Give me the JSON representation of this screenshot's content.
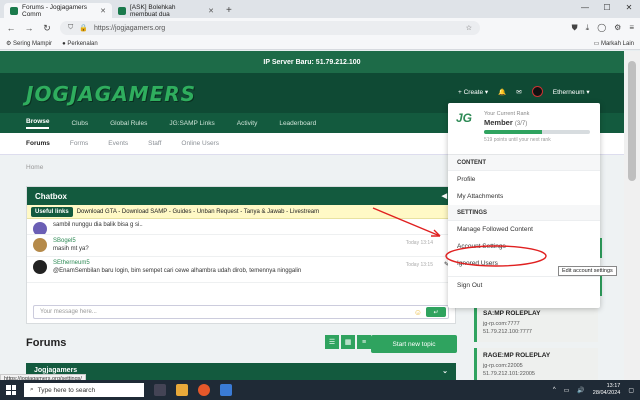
{
  "browser": {
    "tabs": [
      {
        "title": "Forums - Jogjagamers Comm",
        "active": true
      },
      {
        "title": "[ASK] Bolehkah membuat dua",
        "active": false
      }
    ],
    "url": "https://jogjagamers.org",
    "bookmarks": [
      "Sering Mampir",
      "Perkenalan"
    ],
    "other_bookmarks": "Markah Lain"
  },
  "site": {
    "server_banner": "IP Server Baru: 51.79.212.100",
    "logo_text": "JOGJAGAMERS",
    "header": {
      "create_label": "Create",
      "username": "Etherneum"
    },
    "main_nav": [
      "Browse",
      "Clubs",
      "Global Rules",
      "JG:SAMP Links",
      "Activity",
      "Leaderboard"
    ],
    "sub_nav": [
      "Forums",
      "Forms",
      "Events",
      "Staff",
      "Online Users"
    ],
    "breadcrumb": "Home"
  },
  "chatbox": {
    "title": "Chatbox",
    "useful_tag": "Useful links",
    "useful_links": "Download GTA - Download SAMP - Guides - Unban Request - Tanya & Jawab - Livestream",
    "messages": [
      {
        "name": "",
        "text": "sambil nunggu dia balik bisa g si..",
        "time": "",
        "color": "#6b5fb5"
      },
      {
        "name": "SBogel5",
        "text": "masih mt ya?",
        "time": "Today 13:14",
        "color": "#b58a4a"
      },
      {
        "name": "SEtherneum5",
        "text": "@EnamSembilan baru login, bim sempet cari cewe alhambra udah dirob, temennya ninggalin",
        "time": "Today 13:15",
        "color": "#222222"
      }
    ],
    "input_placeholder": "Your message here..."
  },
  "forums": {
    "title": "Forums",
    "new_topic": "Start new topic",
    "category": "Jogjagamers"
  },
  "dropdown": {
    "rank_caption": "Your Current Rank",
    "rank_name": "Member",
    "rank_count": "(3/7)",
    "rank_progress": 0.55,
    "rank_note": "519 points until your next rank",
    "section_content": "CONTENT",
    "items_content": [
      "Profile",
      "My Attachments"
    ],
    "section_settings": "SETTINGS",
    "items_settings": [
      "Manage Followed Content",
      "Account Settings",
      "Ignored Users"
    ],
    "sign_out": "Sign Out"
  },
  "tooltip": "Edit account settings",
  "status_url": "https://jogjagamers.org/settings/",
  "sidebar_servers": [
    {
      "name": "SA:MP ROLEPLAY",
      "lines": [
        "jg-rp.com:7777",
        "51.79.212.100:7777"
      ]
    },
    {
      "name": "RAGE:MP ROLEPLAY",
      "lines": [
        "jg-rp.com:22005",
        "51.79.212.101:22005"
      ]
    }
  ],
  "taskbar": {
    "search_placeholder": "Type here to search",
    "time": "13:17",
    "date": "28/04/2024"
  },
  "colors": {
    "primary": "#135a3e",
    "accent": "#2fa35f",
    "annotation": "#e02020"
  }
}
